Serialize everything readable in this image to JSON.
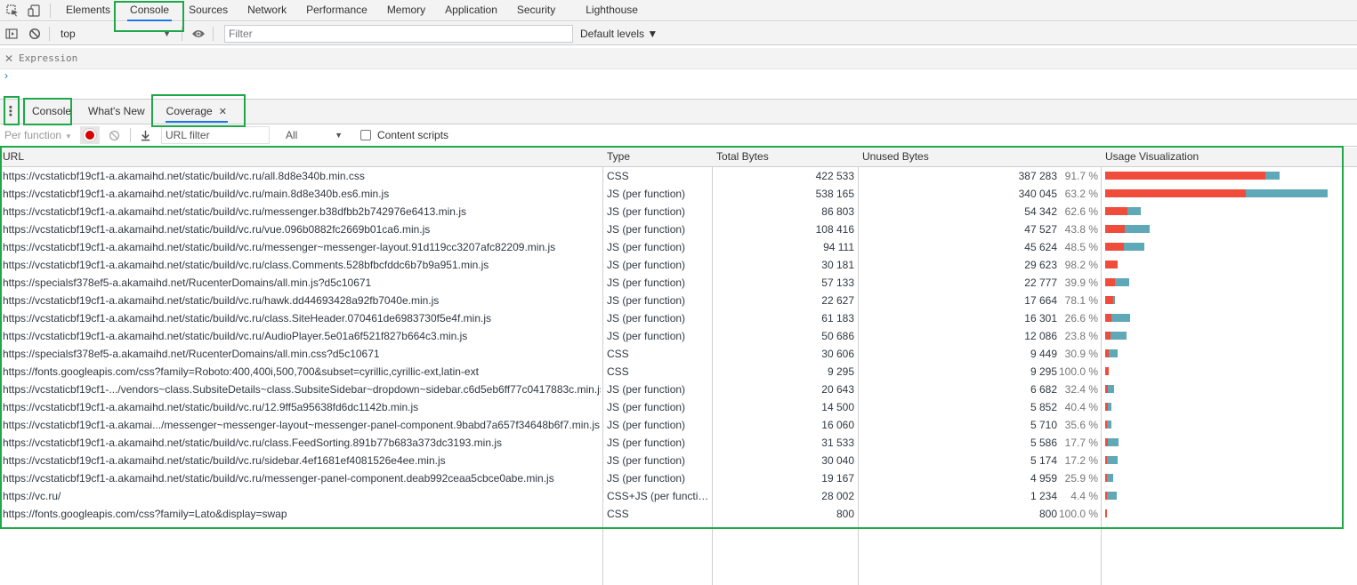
{
  "main_tabs": {
    "items": [
      "Elements",
      "Console",
      "Sources",
      "Network",
      "Performance",
      "Memory",
      "Application",
      "Security",
      "Lighthouse"
    ],
    "selected": "Console"
  },
  "console_toolbar": {
    "context": "top",
    "filter_placeholder": "Filter",
    "levels": "Default levels ▼"
  },
  "console": {
    "expression_label": "Expression",
    "prompt_symbol": "›"
  },
  "drawer": {
    "tabs": [
      "Console",
      "What's New",
      "Coverage"
    ],
    "selected": "Coverage"
  },
  "coverage_toolbar": {
    "mode": "Per function",
    "url_filter_placeholder": "URL filter",
    "type_filter": "All",
    "content_scripts_label": "Content scripts"
  },
  "table": {
    "columns": [
      "URL",
      "Type",
      "Total Bytes",
      "Unused Bytes",
      "Usage Visualization"
    ],
    "colors": {
      "unused": "#ef4c3b",
      "used": "#5fa8b7"
    },
    "rows": [
      {
        "url": "https://vcstaticbf19cf1-a.akamaihd.net/static/build/vc.ru/all.8d8e340b.min.css",
        "type": "CSS",
        "total": "422 533",
        "total_bytes": 422533,
        "unused": "387 283",
        "unused_bytes": 387283,
        "pct": "91.7 %"
      },
      {
        "url": "https://vcstaticbf19cf1-a.akamaihd.net/static/build/vc.ru/main.8d8e340b.es6.min.js",
        "type": "JS (per function)",
        "total": "538 165",
        "total_bytes": 538165,
        "unused": "340 045",
        "unused_bytes": 340045,
        "pct": "63.2 %"
      },
      {
        "url": "https://vcstaticbf19cf1-a.akamaihd.net/static/build/vc.ru/messenger.b38dfbb2b742976e6413.min.js",
        "type": "JS (per function)",
        "total": "86 803",
        "total_bytes": 86803,
        "unused": "54 342",
        "unused_bytes": 54342,
        "pct": "62.6 %"
      },
      {
        "url": "https://vcstaticbf19cf1-a.akamaihd.net/static/build/vc.ru/vue.096b0882fc2669b01ca6.min.js",
        "type": "JS (per function)",
        "total": "108 416",
        "total_bytes": 108416,
        "unused": "47 527",
        "unused_bytes": 47527,
        "pct": "43.8 %"
      },
      {
        "url": "https://vcstaticbf19cf1-a.akamaihd.net/static/build/vc.ru/messenger~messenger-layout.91d119cc3207afc82209.min.js",
        "type": "JS (per function)",
        "total": "94 111",
        "total_bytes": 94111,
        "unused": "45 624",
        "unused_bytes": 45624,
        "pct": "48.5 %"
      },
      {
        "url": "https://vcstaticbf19cf1-a.akamaihd.net/static/build/vc.ru/class.Comments.528bfbcfddc6b7b9a951.min.js",
        "type": "JS (per function)",
        "total": "30 181",
        "total_bytes": 30181,
        "unused": "29 623",
        "unused_bytes": 29623,
        "pct": "98.2 %"
      },
      {
        "url": "https://specialsf378ef5-a.akamaihd.net/RucenterDomains/all.min.js?d5c10671",
        "type": "JS (per function)",
        "total": "57 133",
        "total_bytes": 57133,
        "unused": "22 777",
        "unused_bytes": 22777,
        "pct": "39.9 %"
      },
      {
        "url": "https://vcstaticbf19cf1-a.akamaihd.net/static/build/vc.ru/hawk.dd44693428a92fb7040e.min.js",
        "type": "JS (per function)",
        "total": "22 627",
        "total_bytes": 22627,
        "unused": "17 664",
        "unused_bytes": 17664,
        "pct": "78.1 %"
      },
      {
        "url": "https://vcstaticbf19cf1-a.akamaihd.net/static/build/vc.ru/class.SiteHeader.070461de6983730f5e4f.min.js",
        "type": "JS (per function)",
        "total": "61 183",
        "total_bytes": 61183,
        "unused": "16 301",
        "unused_bytes": 16301,
        "pct": "26.6 %"
      },
      {
        "url": "https://vcstaticbf19cf1-a.akamaihd.net/static/build/vc.ru/AudioPlayer.5e01a6f521f827b664c3.min.js",
        "type": "JS (per function)",
        "total": "50 686",
        "total_bytes": 50686,
        "unused": "12 086",
        "unused_bytes": 12086,
        "pct": "23.8 %"
      },
      {
        "url": "https://specialsf378ef5-a.akamaihd.net/RucenterDomains/all.min.css?d5c10671",
        "type": "CSS",
        "total": "30 606",
        "total_bytes": 30606,
        "unused": "9 449",
        "unused_bytes": 9449,
        "pct": "30.9 %"
      },
      {
        "url": "https://fonts.googleapis.com/css?family=Roboto:400,400i,500,700&subset=cyrillic,cyrillic-ext,latin-ext",
        "type": "CSS",
        "total": "9 295",
        "total_bytes": 9295,
        "unused": "9 295",
        "unused_bytes": 9295,
        "pct": "100.0 %"
      },
      {
        "url": "https://vcstaticbf19cf1-.../vendors~class.SubsiteDetails~class.SubsiteSidebar~dropdown~sidebar.c6d5eb6ff77c0417883c.min.js",
        "type": "JS (per function)",
        "total": "20 643",
        "total_bytes": 20643,
        "unused": "6 682",
        "unused_bytes": 6682,
        "pct": "32.4 %"
      },
      {
        "url": "https://vcstaticbf19cf1-a.akamaihd.net/static/build/vc.ru/12.9ff5a95638fd6dc1142b.min.js",
        "type": "JS (per function)",
        "total": "14 500",
        "total_bytes": 14500,
        "unused": "5 852",
        "unused_bytes": 5852,
        "pct": "40.4 %"
      },
      {
        "url": "https://vcstaticbf19cf1-a.akamai.../messenger~messenger-layout~messenger-panel-component.9babd7a657f34648b6f7.min.js",
        "type": "JS (per function)",
        "total": "16 060",
        "total_bytes": 16060,
        "unused": "5 710",
        "unused_bytes": 5710,
        "pct": "35.6 %"
      },
      {
        "url": "https://vcstaticbf19cf1-a.akamaihd.net/static/build/vc.ru/class.FeedSorting.891b77b683a373dc3193.min.js",
        "type": "JS (per function)",
        "total": "31 533",
        "total_bytes": 31533,
        "unused": "5 586",
        "unused_bytes": 5586,
        "pct": "17.7 %"
      },
      {
        "url": "https://vcstaticbf19cf1-a.akamaihd.net/static/build/vc.ru/sidebar.4ef1681ef4081526e4ee.min.js",
        "type": "JS (per function)",
        "total": "30 040",
        "total_bytes": 30040,
        "unused": "5 174",
        "unused_bytes": 5174,
        "pct": "17.2 %"
      },
      {
        "url": "https://vcstaticbf19cf1-a.akamaihd.net/static/build/vc.ru/messenger-panel-component.deab992ceaa5cbce0abe.min.js",
        "type": "JS (per function)",
        "total": "19 167",
        "total_bytes": 19167,
        "unused": "4 959",
        "unused_bytes": 4959,
        "pct": "25.9 %"
      },
      {
        "url": "https://vc.ru/",
        "type": "CSS+JS (per functio…",
        "total": "28 002",
        "total_bytes": 28002,
        "unused": "1 234",
        "unused_bytes": 1234,
        "pct": "4.4 %"
      },
      {
        "url": "https://fonts.googleapis.com/css?family=Lato&display=swap",
        "type": "CSS",
        "total": "800",
        "total_bytes": 800,
        "unused": "800",
        "unused_bytes": 800,
        "pct": "100.0 %"
      }
    ]
  }
}
